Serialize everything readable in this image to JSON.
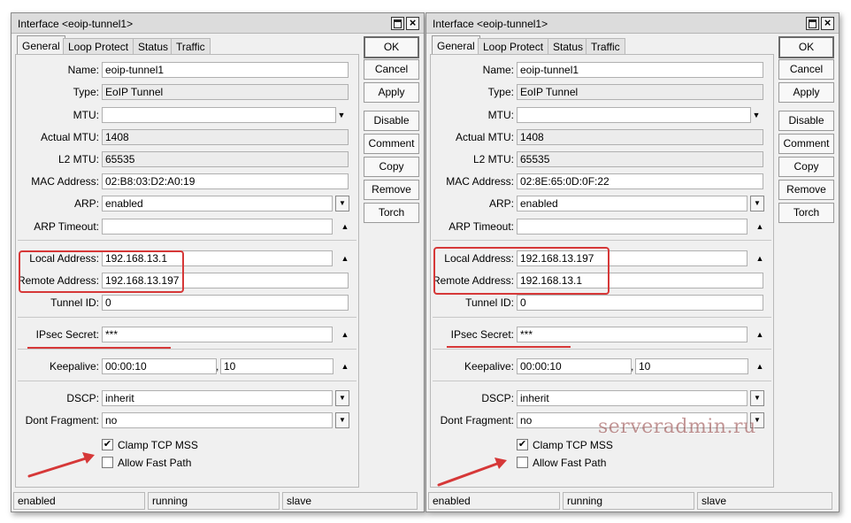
{
  "colors": {
    "annotation": "#d63838",
    "window_bg": "#f0f0f0"
  },
  "windows": [
    {
      "title": "Interface <eoip-tunnel1>",
      "tabs": [
        "General",
        "Loop Protect",
        "Status",
        "Traffic"
      ],
      "fields": {
        "name": {
          "label": "Name:",
          "value": "eoip-tunnel1"
        },
        "type": {
          "label": "Type:",
          "value": "EoIP Tunnel"
        },
        "mtu": {
          "label": "MTU:",
          "value": ""
        },
        "actual_mtu": {
          "label": "Actual MTU:",
          "value": "1408"
        },
        "l2_mtu": {
          "label": "L2 MTU:",
          "value": "65535"
        },
        "mac": {
          "label": "MAC Address:",
          "value": "02:B8:03:D2:A0:19"
        },
        "arp": {
          "label": "ARP:",
          "value": "enabled"
        },
        "arp_timeout": {
          "label": "ARP Timeout:",
          "value": ""
        },
        "local_address": {
          "label": "Local Address:",
          "value": "192.168.13.1"
        },
        "remote_address": {
          "label": "Remote Address:",
          "value": "192.168.13.197"
        },
        "tunnel_id": {
          "label": "Tunnel ID:",
          "value": "0"
        },
        "ipsec_secret": {
          "label": "IPsec Secret:",
          "value": "***"
        },
        "keepalive": {
          "label": "Keepalive:",
          "value": "00:00:10",
          "value2": "10",
          "separator": ","
        },
        "dscp": {
          "label": "DSCP:",
          "value": "inherit"
        },
        "dont_fragment": {
          "label": "Dont Fragment:",
          "value": "no"
        }
      },
      "checkboxes": {
        "clamp_tcp_mss": {
          "label": "Clamp TCP MSS",
          "checked": true
        },
        "allow_fast_path": {
          "label": "Allow Fast Path",
          "checked": false
        }
      },
      "buttons": [
        "OK",
        "Cancel",
        "Apply",
        "Disable",
        "Comment",
        "Copy",
        "Remove",
        "Torch"
      ],
      "status": [
        "enabled",
        "running",
        "slave"
      ]
    },
    {
      "title": "Interface <eoip-tunnel1>",
      "tabs": [
        "General",
        "Loop Protect",
        "Status",
        "Traffic"
      ],
      "fields": {
        "name": {
          "label": "Name:",
          "value": "eoip-tunnel1"
        },
        "type": {
          "label": "Type:",
          "value": "EoIP Tunnel"
        },
        "mtu": {
          "label": "MTU:",
          "value": ""
        },
        "actual_mtu": {
          "label": "Actual MTU:",
          "value": "1408"
        },
        "l2_mtu": {
          "label": "L2 MTU:",
          "value": "65535"
        },
        "mac": {
          "label": "MAC Address:",
          "value": "02:8E:65:0D:0F:22"
        },
        "arp": {
          "label": "ARP:",
          "value": "enabled"
        },
        "arp_timeout": {
          "label": "ARP Timeout:",
          "value": ""
        },
        "local_address": {
          "label": "Local Address:",
          "value": "192.168.13.197"
        },
        "remote_address": {
          "label": "Remote Address:",
          "value": "192.168.13.1"
        },
        "tunnel_id": {
          "label": "Tunnel ID:",
          "value": "0"
        },
        "ipsec_secret": {
          "label": "IPsec Secret:",
          "value": "***"
        },
        "keepalive": {
          "label": "Keepalive:",
          "value": "00:00:10",
          "value2": "10",
          "separator": ","
        },
        "dscp": {
          "label": "DSCP:",
          "value": "inherit"
        },
        "dont_fragment": {
          "label": "Dont Fragment:",
          "value": "no"
        }
      },
      "checkboxes": {
        "clamp_tcp_mss": {
          "label": "Clamp TCP MSS",
          "checked": true
        },
        "allow_fast_path": {
          "label": "Allow Fast Path",
          "checked": false
        }
      },
      "buttons": [
        "OK",
        "Cancel",
        "Apply",
        "Disable",
        "Comment",
        "Copy",
        "Remove",
        "Torch"
      ],
      "status": [
        "enabled",
        "running",
        "slave"
      ]
    }
  ],
  "watermark": "serveradmin.ru"
}
